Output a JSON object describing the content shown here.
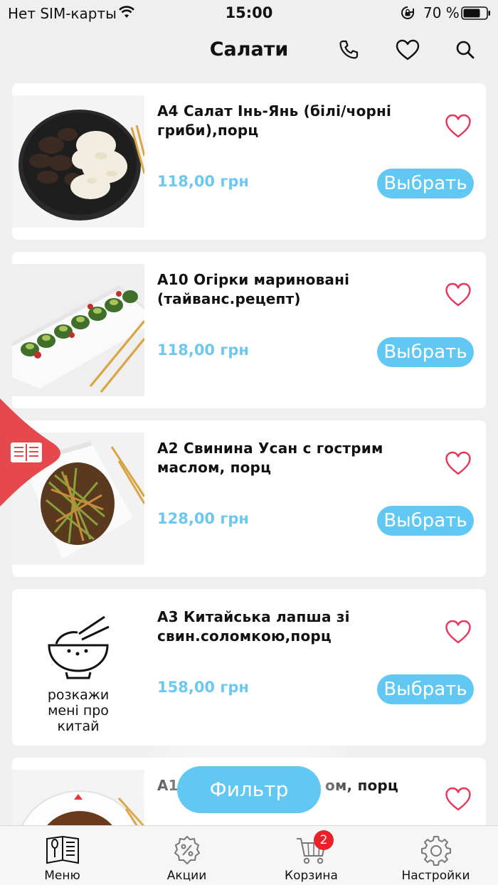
{
  "status_bar": {
    "carrier": "Нет SIM-карты",
    "time": "15:00",
    "battery": "70 %"
  },
  "header": {
    "title": "Салати",
    "icons": [
      "phone-icon",
      "heart-icon",
      "search-icon"
    ]
  },
  "products": [
    {
      "name": "А4 Салат Інь-Янь (білі/чорні гриби),порц",
      "price": "118,00 грн",
      "button": "Выбрать"
    },
    {
      "name": "А10 Огірки мариновані (тайванс.рецепт)",
      "price": "118,00 грн",
      "button": "Выбрать"
    },
    {
      "name": "А2 Свинина Усан с гострим маслом, порц",
      "price": "128,00 грн",
      "button": "Выбрать"
    },
    {
      "name": "А3 Китайська лапша зі свин.соломкою,порц",
      "price": "158,00 грн",
      "button": "Выбрать"
    },
    {
      "name_start": "А1",
      "name_end": "ом, порц"
    }
  ],
  "placeholder_logo": {
    "line1": "розкажи",
    "line2": "мені про",
    "line3": "китай"
  },
  "filter_label": "Фильтр",
  "tabbar": [
    {
      "label": "Меню",
      "icon": "menu-book-icon"
    },
    {
      "label": "Акции",
      "icon": "discount-gear-icon"
    },
    {
      "label": "Корзина",
      "icon": "cart-icon",
      "badge": "2"
    },
    {
      "label": "Настройки",
      "icon": "settings-icon"
    }
  ],
  "colors": {
    "accent": "#61c8f3",
    "price": "#6cc8f0",
    "heart": "#e8355a",
    "side_tab": "#e5494e",
    "badge": "#e8222b"
  }
}
